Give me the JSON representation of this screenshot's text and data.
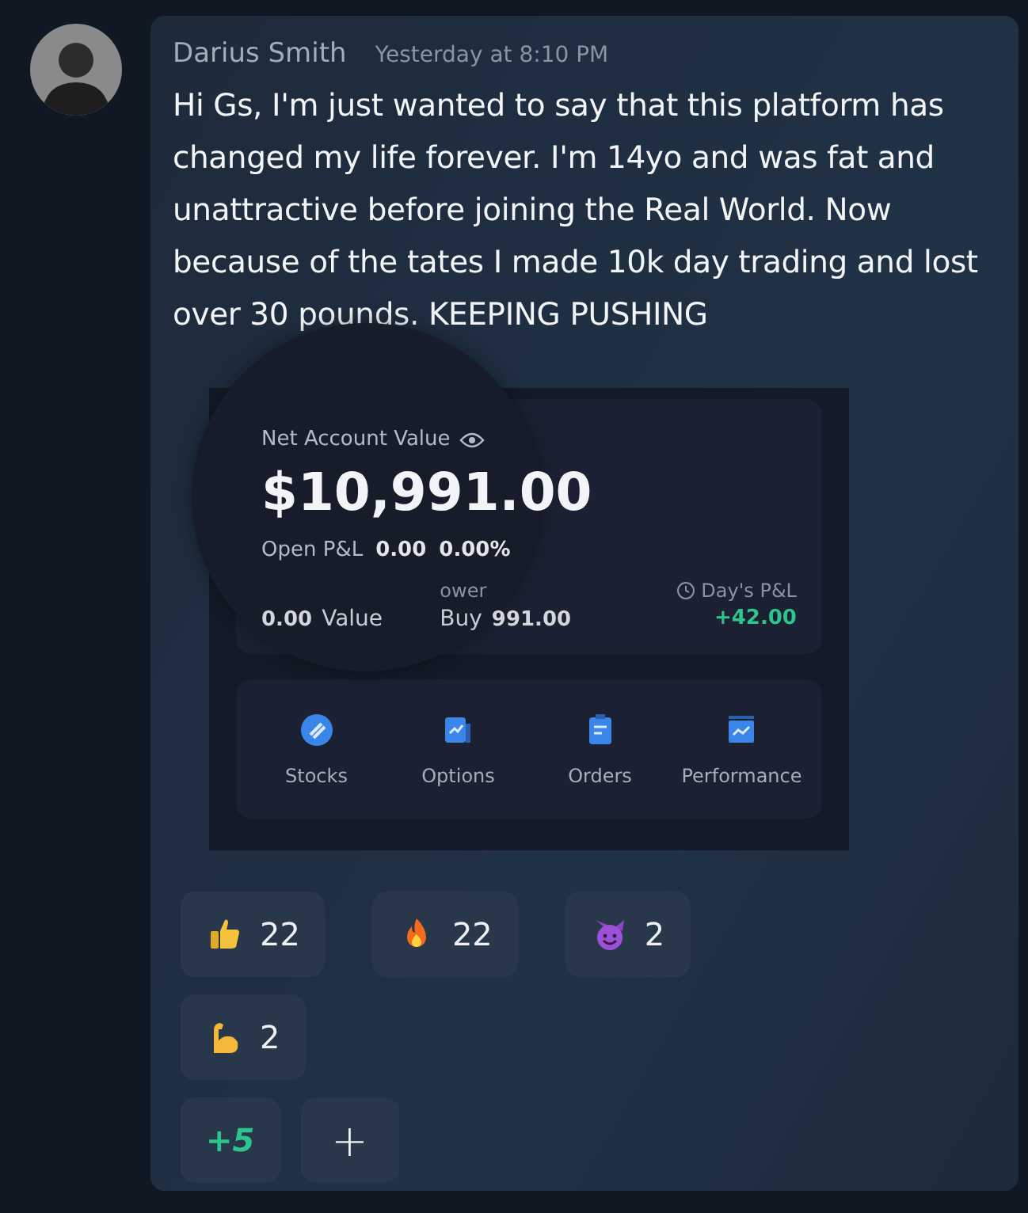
{
  "message": {
    "author": "Darius Smith",
    "timestamp": "Yesterday at 8:10 PM",
    "text": "Hi Gs, I'm just wanted to say that this platform has changed my life forever. I'm 14yo and was fat and unattractive before joining the Real World. Now because of the tates I made 10k day trading and lost over 30 pounds. KEEPING PUSHING"
  },
  "screenshot": {
    "title": "Net Account Value",
    "value": "$10,991.00",
    "open_pnl_label": "Open P&L",
    "open_pnl": "0.00",
    "open_pnl_pct": "0.00%",
    "stats": [
      {
        "kind": "plain",
        "value": "0.00",
        "fragment": "Value"
      },
      {
        "kind": "plain",
        "label": "ower",
        "prefix": "Buy",
        "value": "991.00"
      },
      {
        "kind": "gain",
        "label": "Day's P&L",
        "value": "+42.00"
      }
    ],
    "nav": [
      {
        "kind": "stocks",
        "label": "Stocks"
      },
      {
        "kind": "options",
        "label": "Options"
      },
      {
        "kind": "orders",
        "label": "Orders"
      },
      {
        "kind": "performance",
        "label": "Performance"
      }
    ]
  },
  "reactions": [
    {
      "kind": "thumbs",
      "count": "22"
    },
    {
      "kind": "fire",
      "count": "22"
    },
    {
      "kind": "devil",
      "count": "2"
    },
    {
      "kind": "muscle",
      "count": "2"
    }
  ],
  "more_reactions": "+5",
  "add_reaction": "+"
}
